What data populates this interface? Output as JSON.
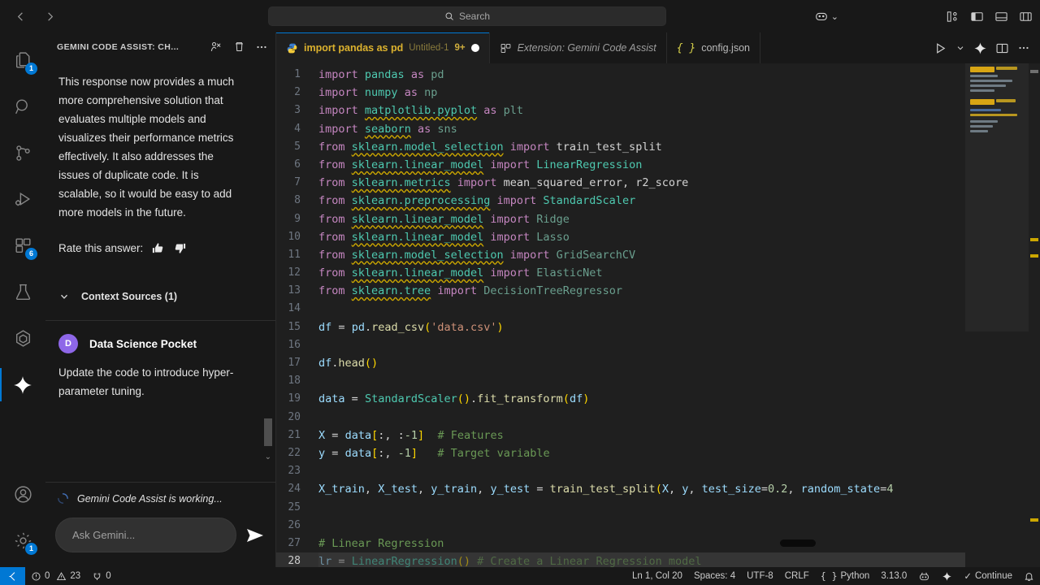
{
  "titlebar": {
    "back_label": "←",
    "forward_label": "→",
    "search_placeholder": "Search",
    "search_icon": "search-icon",
    "remote_icon": "remote-window-icon",
    "chevron": "⌄",
    "layout_icons": [
      "customize-layout-icon",
      "toggle-primary-sidebar-icon",
      "toggle-panel-icon",
      "toggle-secondary-sidebar-icon"
    ]
  },
  "activitybar": {
    "items": [
      {
        "name": "explorer",
        "icon": "files-icon",
        "badge": "1",
        "active": false
      },
      {
        "name": "search",
        "icon": "search-icon",
        "badge": "",
        "active": false
      },
      {
        "name": "source-control",
        "icon": "source-control-icon",
        "badge": "",
        "active": false
      },
      {
        "name": "run-and-debug",
        "icon": "run-debug-icon",
        "badge": "",
        "active": false
      },
      {
        "name": "extensions",
        "icon": "extensions-icon",
        "badge": "6",
        "active": false
      },
      {
        "name": "testing",
        "icon": "beaker-icon",
        "badge": "",
        "active": false
      },
      {
        "name": "remote-explorer",
        "icon": "hexagon-icon",
        "badge": "",
        "active": false
      },
      {
        "name": "gemini-code-assist",
        "icon": "sparkle-icon",
        "badge": "",
        "active": true
      }
    ],
    "bottom": [
      {
        "name": "accounts",
        "icon": "account-icon",
        "badge": ""
      },
      {
        "name": "settings",
        "icon": "gear-icon",
        "badge": "1"
      }
    ]
  },
  "sidebar": {
    "title": "GEMINI CODE ASSIST: CH...",
    "actions": [
      {
        "name": "new-chat-button",
        "icon": "new-chat-icon"
      },
      {
        "name": "clear-chat-button",
        "icon": "trash-icon"
      },
      {
        "name": "more-actions-button",
        "icon": "ellipsis-icon"
      }
    ],
    "response_text": "This response now provides a much more comprehensive solution that evaluates multiple models and visualizes their performance metrics effectively. It also addresses the issues of duplicate code. It is scalable, so it would be easy to add more models in the future.",
    "rate_label": "Rate this answer:",
    "thumbs_up_icon": "thumbs-up-icon",
    "thumbs_down_icon": "thumbs-down-icon",
    "context_sources_label": "Context Sources (1)",
    "context_chevron": "chevron-down-icon",
    "user": {
      "avatar_initial": "D",
      "avatar_color": "#8e67e8",
      "name": "Data Science Pocket",
      "message": "Update the code to introduce hyper-parameter tuning."
    },
    "working_text": "Gemini Code Assist is working...",
    "working_icon": "loading-spinner-icon",
    "ask_placeholder": "Ask Gemini...",
    "send_icon": "send-icon"
  },
  "tabs": [
    {
      "name": "tab-untitled-1",
      "icon": "python-file-icon",
      "title": "import pandas as pd",
      "description": "Untitled-1",
      "badge": "9+",
      "dirty": true,
      "active": true
    },
    {
      "name": "tab-extension-gemini-code-assist",
      "icon": "extensions-icon",
      "title": "Extension: Gemini Code Assist",
      "description": "",
      "badge": "",
      "dirty": false,
      "active": false
    },
    {
      "name": "tab-config-json",
      "icon": "json-file-icon",
      "title": "config.json",
      "description": "",
      "badge": "",
      "dirty": false,
      "active": false
    }
  ],
  "tabbar_actions": [
    {
      "name": "run-python-file-button",
      "icon": "run-icon"
    },
    {
      "name": "run-options-dropdown",
      "icon": "chevron-down-icon"
    },
    {
      "name": "gemini-sparkle-button",
      "icon": "sparkle-icon"
    },
    {
      "name": "split-editor-button",
      "icon": "split-editor-icon"
    },
    {
      "name": "editor-more-actions-button",
      "icon": "ellipsis-icon"
    }
  ],
  "editor": {
    "language": "python",
    "lines": [
      {
        "n": 1,
        "text": "import pandas as pd"
      },
      {
        "n": 2,
        "text": "import numpy as np"
      },
      {
        "n": 3,
        "text": "import matplotlib.pyplot as plt"
      },
      {
        "n": 4,
        "text": "import seaborn as sns"
      },
      {
        "n": 5,
        "text": "from sklearn.model_selection import train_test_split"
      },
      {
        "n": 6,
        "text": "from sklearn.linear_model import LinearRegression"
      },
      {
        "n": 7,
        "text": "from sklearn.metrics import mean_squared_error, r2_score"
      },
      {
        "n": 8,
        "text": "from sklearn.preprocessing import StandardScaler"
      },
      {
        "n": 9,
        "text": "from sklearn.linear_model import Ridge"
      },
      {
        "n": 10,
        "text": "from sklearn.linear_model import Lasso"
      },
      {
        "n": 11,
        "text": "from sklearn.model_selection import GridSearchCV"
      },
      {
        "n": 12,
        "text": "from sklearn.linear_model import ElasticNet"
      },
      {
        "n": 13,
        "text": "from sklearn.tree import DecisionTreeRegressor"
      },
      {
        "n": 14,
        "text": ""
      },
      {
        "n": 15,
        "text": "df = pd.read_csv('data.csv')"
      },
      {
        "n": 16,
        "text": ""
      },
      {
        "n": 17,
        "text": "df.head()"
      },
      {
        "n": 18,
        "text": ""
      },
      {
        "n": 19,
        "text": "data = StandardScaler().fit_transform(df)"
      },
      {
        "n": 20,
        "text": ""
      },
      {
        "n": 21,
        "text": "X = data[:, :-1]  # Features"
      },
      {
        "n": 22,
        "text": "y = data[:, -1]   # Target variable"
      },
      {
        "n": 23,
        "text": ""
      },
      {
        "n": 24,
        "text": "X_train, X_test, y_train, y_test = train_test_split(X, y, test_size=0.2, random_state=4"
      },
      {
        "n": 25,
        "text": ""
      },
      {
        "n": 26,
        "text": ""
      },
      {
        "n": 27,
        "text": "# Linear Regression"
      },
      {
        "n": 28,
        "text": "lr = LinearRegression() # Create a Linear Regression model"
      }
    ]
  },
  "statusbar": {
    "remote_icon": "remote-indicator-icon",
    "errors_icon": "error-icon",
    "errors": "0",
    "warnings_icon": "warning-icon",
    "warnings": "23",
    "ports_icon": "ports-icon",
    "ports": "0",
    "cursor_position": "Ln 1, Col 20",
    "indentation": "Spaces: 4",
    "encoding": "UTF-8",
    "eol": "CRLF",
    "language_icon": "json-brackets-icon",
    "language": "Python",
    "interpreter_version": "3.13.0",
    "pets_icon": "pets-icon",
    "sparkle_icon": "sparkle-icon",
    "continue_check": "✓",
    "continue_label": "Continue",
    "bell_icon": "bell-icon"
  }
}
